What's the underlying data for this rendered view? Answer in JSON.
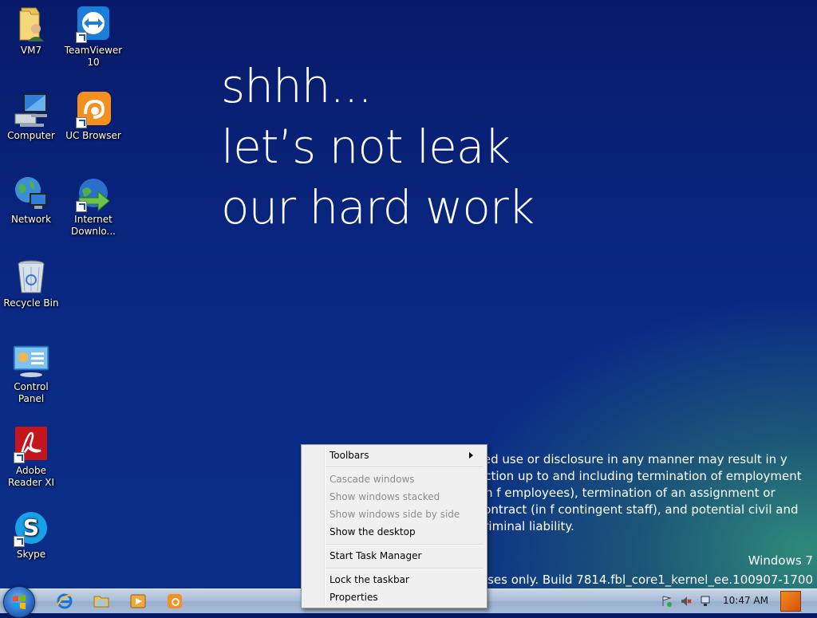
{
  "desktop": {
    "icons": [
      {
        "label": "VM7",
        "icon": "folder-user-icon"
      },
      {
        "label": "TeamViewer 10",
        "icon": "teamviewer-icon"
      },
      {
        "label": "Computer",
        "icon": "computer-icon"
      },
      {
        "label": "UC Browser",
        "icon": "uc-browser-icon"
      },
      {
        "label": "Network",
        "icon": "network-icon"
      },
      {
        "label": "Internet Downlo...",
        "icon": "internet-download-manager-icon"
      },
      {
        "label": "Recycle Bin",
        "icon": "recycle-bin-icon"
      },
      {
        "label": "Control Panel",
        "icon": "control-panel-icon"
      },
      {
        "label": "Adobe Reader XI",
        "icon": "adobe-reader-icon"
      },
      {
        "label": "Skype",
        "icon": "skype-icon"
      }
    ]
  },
  "wallpaper": {
    "headline": [
      "shhh...",
      "let’s not leak",
      "our hard work"
    ],
    "legal": "zed use or disclosure in any manner may result in y action up to and including termination of employment (in f employees), termination of an assignment or contract (in f contingent staff), and potential civil and criminal liability.",
    "os_name": "Windows 7",
    "build": "purposes only. Build 7814.fbl_core1_kernel_ee.100907-1700"
  },
  "context_menu": {
    "items": [
      {
        "label": "Toolbars",
        "enabled": true,
        "submenu": true
      },
      {
        "label": "Cascade windows",
        "enabled": false
      },
      {
        "label": "Show windows stacked",
        "enabled": false
      },
      {
        "label": "Show windows side by side",
        "enabled": false
      },
      {
        "label": "Show the desktop",
        "enabled": true
      },
      {
        "label": "Start Task Manager",
        "enabled": true
      },
      {
        "label": "Lock the taskbar",
        "enabled": true
      },
      {
        "label": "Properties",
        "enabled": true
      }
    ]
  },
  "taskbar": {
    "pinned": [
      "internet-explorer-icon",
      "windows-explorer-icon",
      "media-player-icon",
      "uc-browser-icon"
    ],
    "clock": "10:47 AM",
    "tray_icons": [
      "action-center-icon",
      "volume-muted-icon",
      "network-tray-icon"
    ]
  },
  "colors": {
    "menu_bg": "#f0f0f0",
    "disabled_text": "#8d8d8d",
    "taskbar": "#a9bdd8"
  }
}
